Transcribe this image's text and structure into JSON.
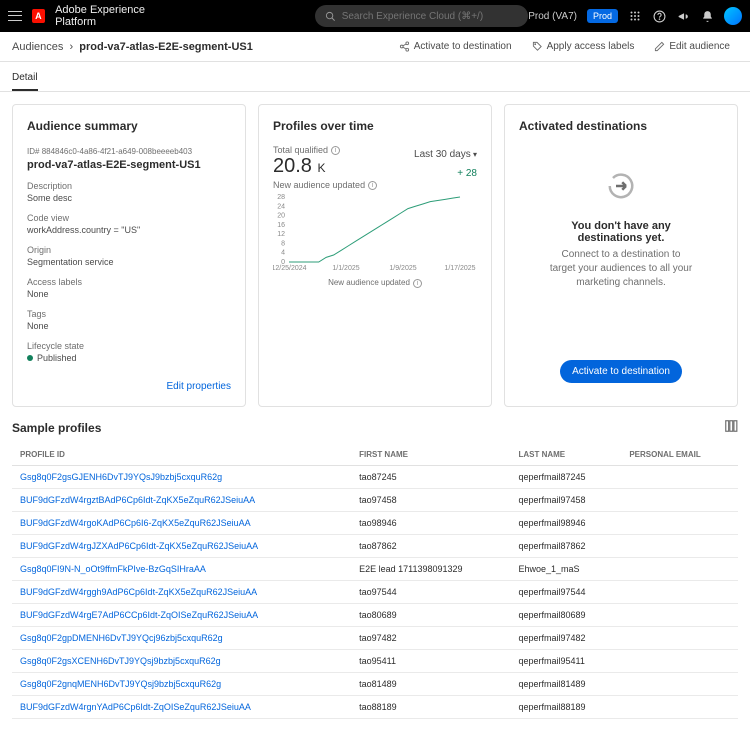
{
  "topbar": {
    "app_name": "Adobe Experience Platform",
    "search_placeholder": "Search Experience Cloud (⌘+/)",
    "env_label": "Prod (VA7)",
    "env_badge": "Prod"
  },
  "breadcrumb": {
    "root": "Audiences",
    "current": "prod-va7-atlas-E2E-segment-US1"
  },
  "actions": {
    "activate": "Activate to destination",
    "access_labels": "Apply access labels",
    "edit": "Edit audience"
  },
  "tabs": {
    "detail": "Detail"
  },
  "summary": {
    "title": "Audience summary",
    "id_label": "ID#",
    "id": "884846c0-4a86-4f21-a649-008beeeeb403",
    "name": "prod-va7-atlas-E2E-segment-US1",
    "desc_label": "Description",
    "desc": "Some desc",
    "code_label": "Code view",
    "code": "workAddress.country = \"US\"",
    "origin_label": "Origin",
    "origin": "Segmentation service",
    "access_label": "Access labels",
    "access": "None",
    "tags_label": "Tags",
    "tags": "None",
    "lifecycle_label": "Lifecycle state",
    "lifecycle": "Published",
    "edit_link": "Edit properties"
  },
  "profiles_over_time": {
    "title": "Profiles over time",
    "qualified_label": "Total qualified",
    "qualified_value": "20.8",
    "qualified_unit": "K",
    "updated_label": "New audience updated",
    "range": "Last 30 days",
    "delta": "+ 28",
    "footer": "New audience updated"
  },
  "chart_data": {
    "type": "line",
    "x_labels": [
      "12/25/2024",
      "1/1/2025",
      "1/9/2025",
      "1/17/2025"
    ],
    "y_ticks": [
      0,
      4,
      8,
      12,
      16,
      20,
      24,
      28
    ],
    "series": [
      {
        "name": "profiles",
        "values": [
          0,
          0,
          0,
          0,
          0,
          2,
          3,
          5,
          7,
          9,
          11,
          13,
          15,
          17,
          19,
          21,
          23,
          24,
          25,
          26,
          26.5,
          27,
          27.5,
          28
        ]
      }
    ],
    "ylim": [
      0,
      28
    ]
  },
  "destinations": {
    "title": "Activated destinations",
    "empty_title": "You don't have any destinations yet.",
    "empty_sub": "Connect to a destination to target your audiences to all your marketing channels.",
    "button": "Activate to destination"
  },
  "samples": {
    "title": "Sample profiles",
    "columns": [
      "PROFILE ID",
      "FIRST NAME",
      "LAST NAME",
      "PERSONAL EMAIL"
    ],
    "rows": [
      {
        "id": "Gsg8q0F2gsGJENH6DvTJ9YQsJ9bzbj5cxquR62g",
        "fn": "tao87245",
        "ln": "qeperfmail87245",
        "em": ""
      },
      {
        "id": "BUF9dGFzdW4rgztBAdP6Cp6Idt-ZqKX5eZquR62JSeiuAA",
        "fn": "tao97458",
        "ln": "qeperfmail97458",
        "em": ""
      },
      {
        "id": "BUF9dGFzdW4rgoKAdP6Cp6I6-ZqKX5eZquR62JSeiuAA",
        "fn": "tao98946",
        "ln": "qeperfmail98946",
        "em": ""
      },
      {
        "id": "BUF9dGFzdW4rgJZXAdP6Cp6Idt-ZqKX5eZquR62JSeiuAA",
        "fn": "tao87862",
        "ln": "qeperfmail87862",
        "em": ""
      },
      {
        "id": "Gsg8q0FI9N-N_oOt9ffmFkPIve-BzGqSIHraAA",
        "fn": "E2E lead 1711398091329",
        "ln": "Ehwoe_1_maS",
        "em": ""
      },
      {
        "id": "BUF9dGFzdW4rggh9AdP6Cp6Idt-ZqKX5eZquR62JSeiuAA",
        "fn": "tao97544",
        "ln": "qeperfmail97544",
        "em": ""
      },
      {
        "id": "BUF9dGFzdW4rgE7AdP6CCp6Idt-ZqOISeZquR62JSeiuAA",
        "fn": "tao80689",
        "ln": "qeperfmail80689",
        "em": ""
      },
      {
        "id": "Gsg8q0F2gpDMENH6DvTJ9YQcj96zbj5cxquR62g",
        "fn": "tao97482",
        "ln": "qeperfmail97482",
        "em": ""
      },
      {
        "id": "Gsg8q0F2gsXCENH6DvTJ9YQsj9bzbj5cxquR62g",
        "fn": "tao95411",
        "ln": "qeperfmail95411",
        "em": ""
      },
      {
        "id": "Gsg8q0F2gnqMENH6DvTJ9YQsj9bzbj5cxquR62g",
        "fn": "tao81489",
        "ln": "qeperfmail81489",
        "em": ""
      },
      {
        "id": "BUF9dGFzdW4rgnYAdP6Cp6Idt-ZqOISeZquR62JSeiuAA",
        "fn": "tao88189",
        "ln": "qeperfmail88189",
        "em": ""
      }
    ]
  }
}
